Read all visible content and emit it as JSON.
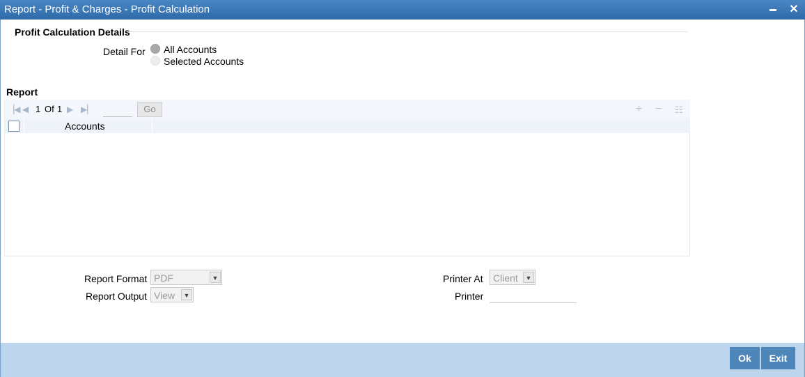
{
  "window": {
    "title": "Report - Profit & Charges - Profit Calculation",
    "minimize_symbol": "▬",
    "close_symbol": "✕"
  },
  "details": {
    "section_title": "Profit Calculation Details",
    "detail_for_label": "Detail For",
    "options": [
      {
        "label": "All Accounts",
        "selected": true
      },
      {
        "label": "Selected Accounts",
        "selected": false
      }
    ]
  },
  "report": {
    "section_title": "Report",
    "pager": {
      "current": "1",
      "of_label": "Of",
      "total": "1",
      "go_label": "Go",
      "page_input_value": ""
    },
    "columns": [
      "Accounts"
    ],
    "rows": []
  },
  "options": {
    "report_format_label": "Report Format",
    "report_format_value": "PDF",
    "report_output_label": "Report Output",
    "report_output_value": "View",
    "printer_at_label": "Printer At",
    "printer_at_value": "Client",
    "printer_label": "Printer",
    "printer_value": ""
  },
  "footer": {
    "ok_label": "Ok",
    "exit_label": "Exit"
  },
  "colors": {
    "title_bar": "#3a78b8",
    "footer_bar": "#bcd5ec",
    "button": "#4f86ba"
  }
}
